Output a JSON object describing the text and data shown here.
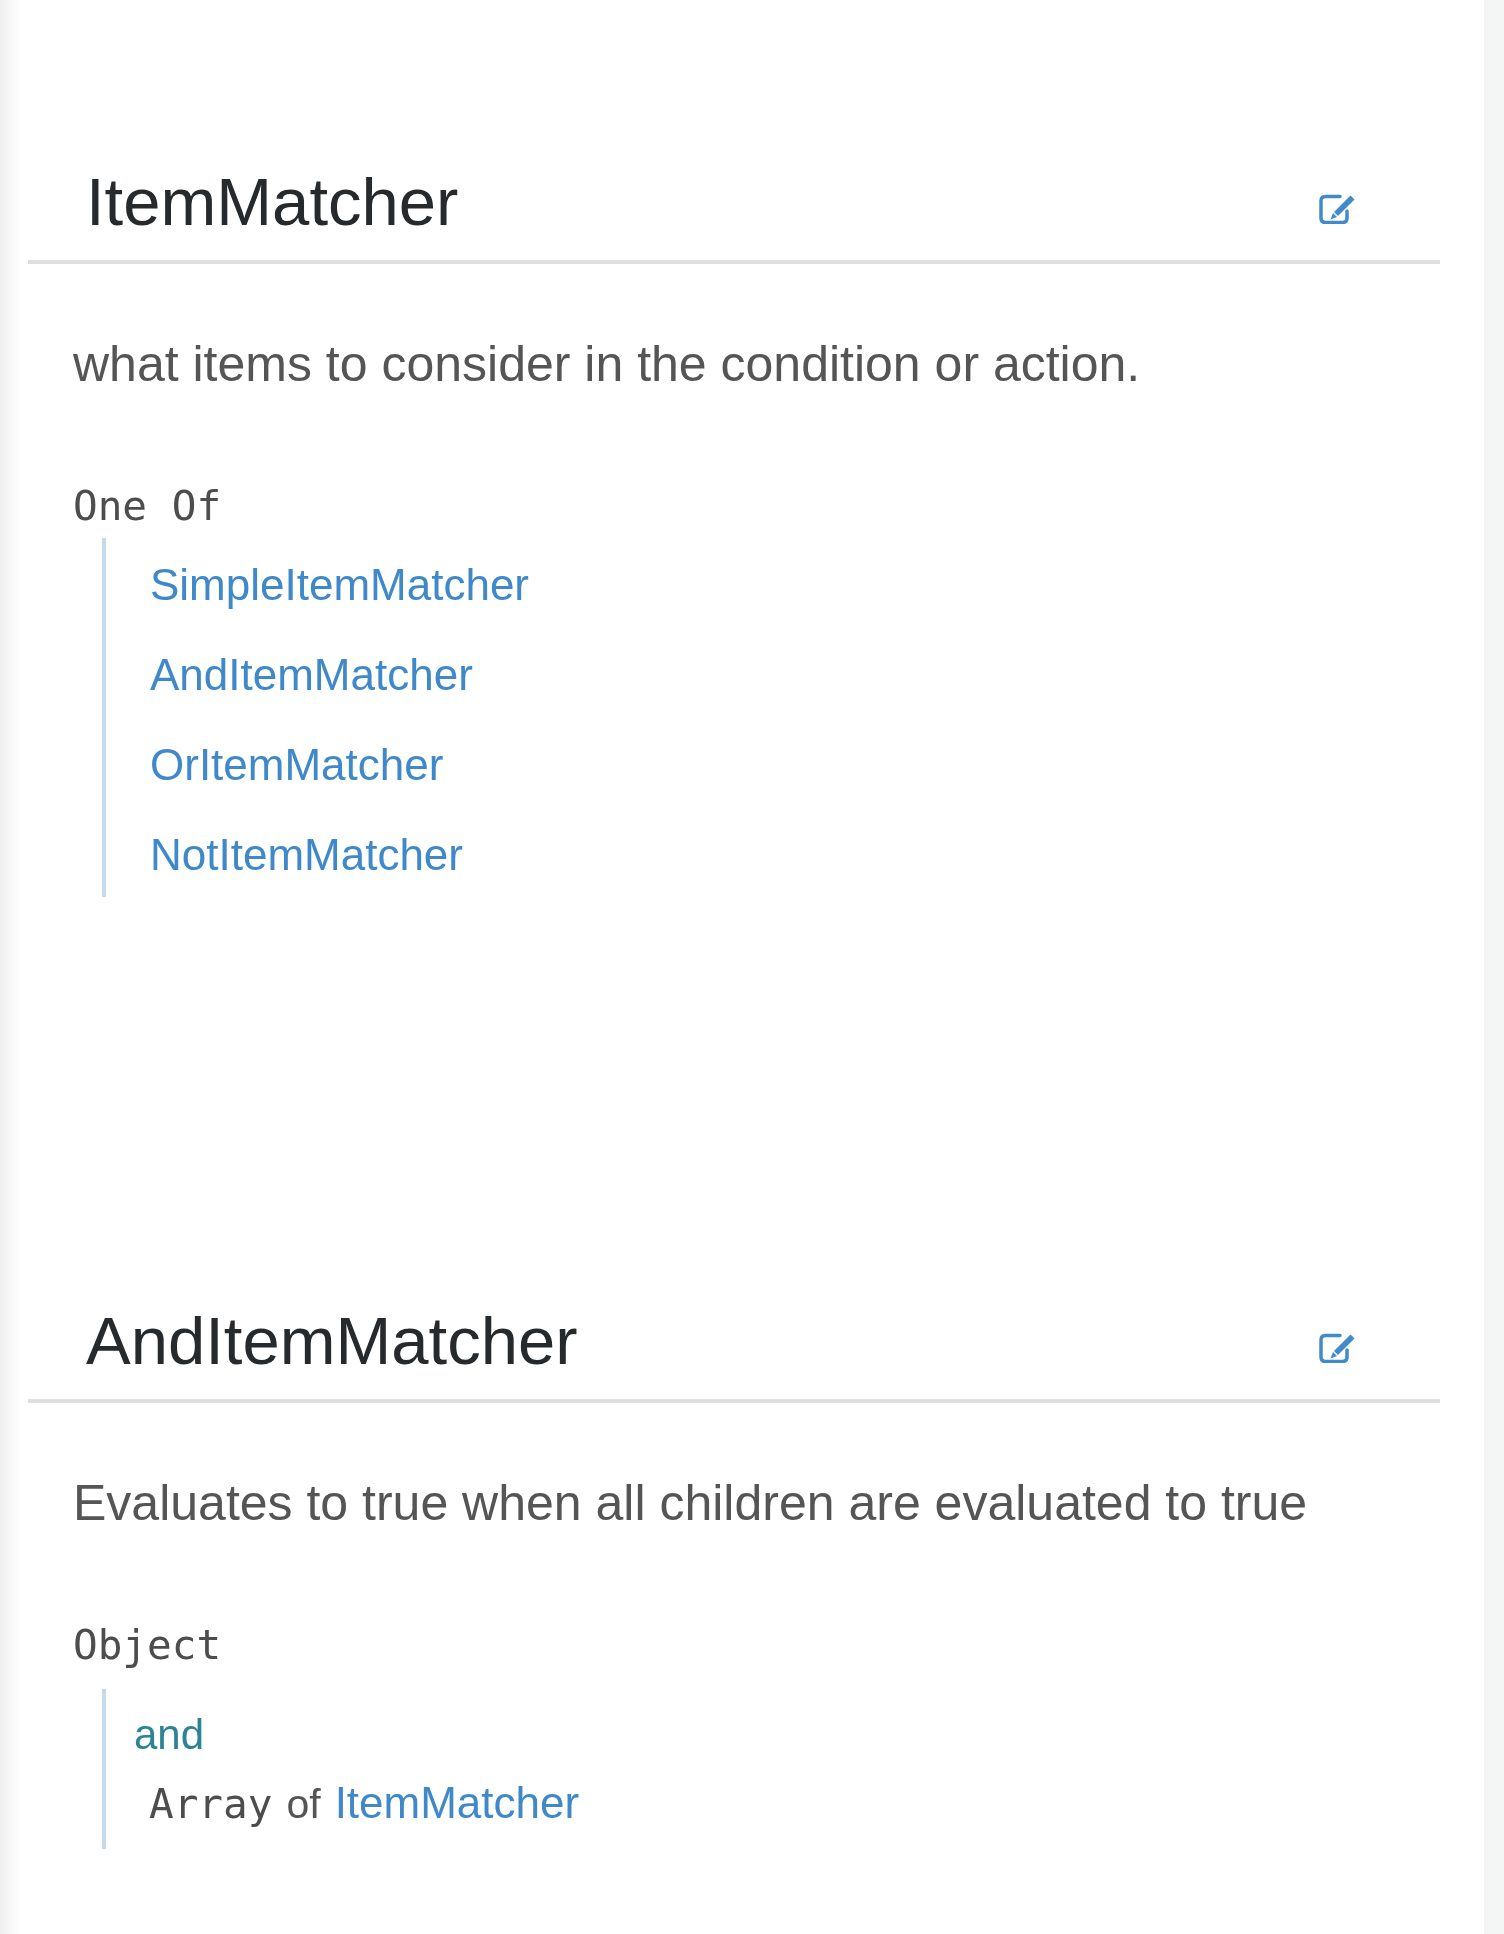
{
  "sections": [
    {
      "kind": "one_of",
      "title": "ItemMatcher",
      "description": "what items to consider in the condition or action.",
      "type_label": "One Of",
      "options": [
        {
          "label": "SimpleItemMatcher"
        },
        {
          "label": "AndItemMatcher"
        },
        {
          "label": "OrItemMatcher"
        },
        {
          "label": "NotItemMatcher"
        }
      ]
    },
    {
      "kind": "object",
      "title": "AndItemMatcher",
      "description": "Evaluates to true when all children are evaluated to true",
      "type_label": "Object",
      "properties": [
        {
          "name": "and",
          "type": "Array",
          "connector": "of",
          "ref": "ItemMatcher"
        }
      ]
    }
  ]
}
